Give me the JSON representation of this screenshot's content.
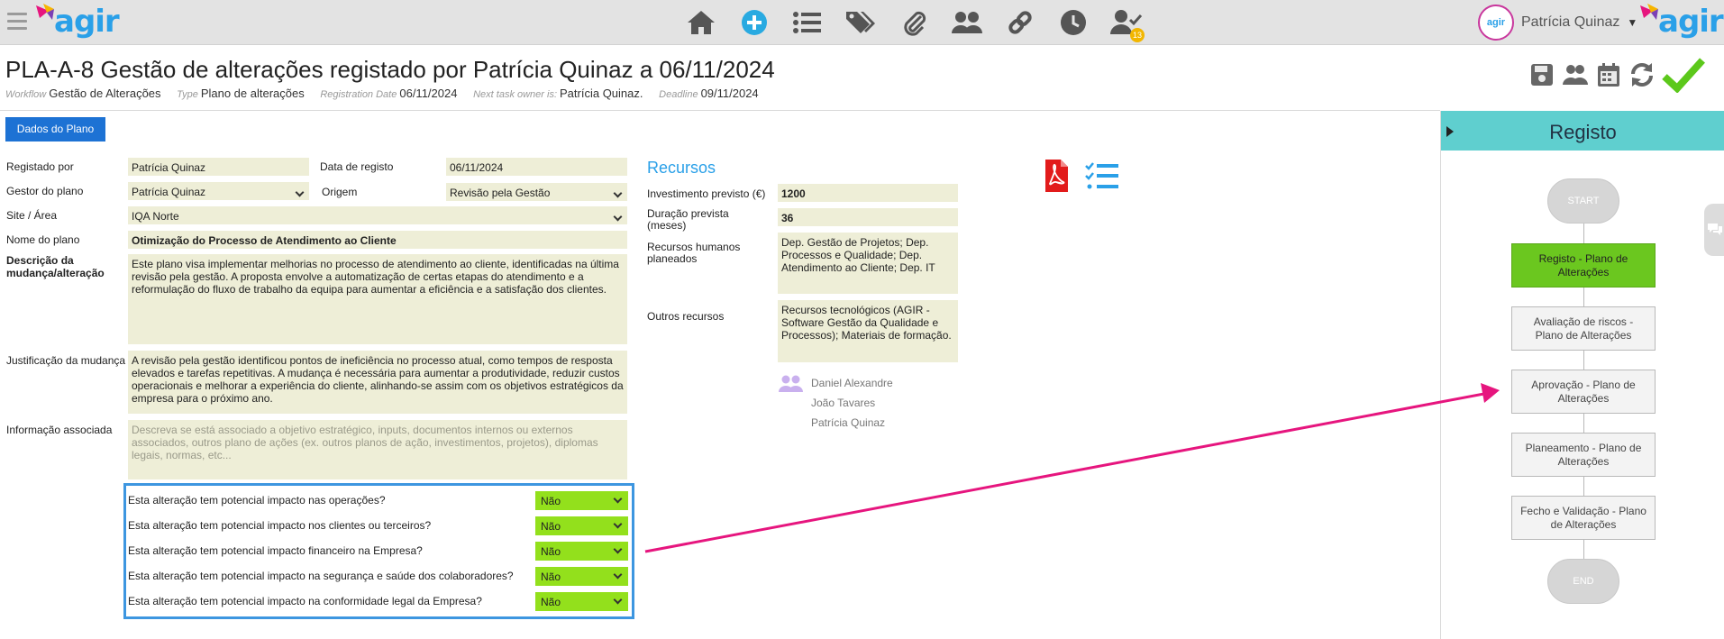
{
  "app": {
    "logo_text": "agir",
    "logo_text_right": "agir",
    "accent": "#2aa0e8",
    "highlight": "#e6157e"
  },
  "nav": {
    "icons": [
      "home-icon",
      "add-circle-icon",
      "list-icon",
      "tags-icon",
      "paperclip-icon",
      "users-icon",
      "link-icon",
      "clock-icon",
      "user-check-icon"
    ],
    "badge": "13"
  },
  "user": {
    "avatar_text": "agir",
    "name": "Patrícia Quinaz"
  },
  "header": {
    "title": "PLA-A-8 Gestão de alterações registado por Patrícia Quinaz a 06/11/2024",
    "meta": [
      {
        "k": "Workflow",
        "v": "Gestão de Alterações"
      },
      {
        "k": "Type",
        "v": "Plano de alterações"
      },
      {
        "k": "Registration Date",
        "v": "06/11/2024"
      },
      {
        "k": "Next task owner is:",
        "v": "Patrícia Quinaz."
      },
      {
        "k": "Deadline",
        "v": "09/11/2024"
      }
    ]
  },
  "tools": [
    "save-icon",
    "users-icon",
    "calendar-icon",
    "refresh-icon",
    "check-icon"
  ],
  "tab_button": "Dados do Plano",
  "form": {
    "registado_por": {
      "label": "Registado por",
      "value": "Patrícia Quinaz"
    },
    "data_registo": {
      "label": "Data de registo",
      "value": "06/11/2024"
    },
    "gestor": {
      "label": "Gestor do plano",
      "value": "Patrícia Quinaz"
    },
    "origem": {
      "label": "Origem",
      "value": "Revisão pela Gestão"
    },
    "site": {
      "label": "Site / Área",
      "value": "IQA Norte"
    },
    "nome": {
      "label": "Nome do plano",
      "value": "Otimização do Processo de Atendimento ao Cliente"
    },
    "descricao": {
      "label": "Descrição da mudança/alteração",
      "value": "Este plano visa implementar melhorias no processo de atendimento ao cliente, identificadas na última revisão pela gestão. A proposta envolve a automatização de certas etapas do atendimento e a reformulação do fluxo de trabalho da equipa para aumentar a eficiência e a satisfação dos clientes."
    },
    "justificacao": {
      "label": "Justificação da mudança",
      "value": "A revisão pela gestão identificou pontos de ineficiência no processo atual, como tempos de resposta elevados e tarefas repetitivas. A mudança é necessária para aumentar a produtividade, reduzir custos operacionais e melhorar a experiência do cliente, alinhando-se assim com os objetivos estratégicos da empresa para o próximo ano."
    },
    "informacao": {
      "label": "Informação associada",
      "placeholder": "Descreva se está associado a objetivo estratégico, inputs, documentos internos ou externos associados, outros plano de ações (ex. outros planos de ação, investimentos, projetos), diplomas legais, normas, etc..."
    }
  },
  "recursos": {
    "title": "Recursos",
    "investimento": {
      "label": "Investimento previsto (€)",
      "value": "1200"
    },
    "duracao": {
      "label": "Duração prevista (meses)",
      "value": "36"
    },
    "humanos": {
      "label": "Recursos humanos planeados",
      "value": "Dep. Gestão de Projetos; Dep. Processos e Qualidade; Dep. Atendimento ao Cliente; Dep. IT"
    },
    "outros": {
      "label": "Outros recursos",
      "value": "Recursos tecnológicos (AGIR - Software Gestão da Qualidade e Processos); Materiais de formação."
    },
    "team": [
      "Daniel Alexandre",
      "João Tavares",
      "Patrícia Quinaz"
    ]
  },
  "impacts": [
    {
      "q": "Esta alteração tem potencial impacto nas operações?",
      "a": "Não"
    },
    {
      "q": "Esta alteração tem potencial impacto nos clientes ou terceiros?",
      "a": "Não"
    },
    {
      "q": "Esta alteração tem potencial impacto financeiro na Empresa?",
      "a": "Não"
    },
    {
      "q": "Esta alteração tem potencial impacto na segurança e saúde dos colaboradores?",
      "a": "Não"
    },
    {
      "q": "Esta alteração tem potencial impacto na conformidade legal da Empresa?",
      "a": "Não"
    }
  ],
  "workflow": {
    "title": "Registo",
    "start": "START",
    "end": "END",
    "steps": [
      {
        "label": "Registo - Plano de Alterações",
        "active": true
      },
      {
        "label": "Avaliação de riscos - Plano de Alterações",
        "active": false
      },
      {
        "label": "Aprovação - Plano de Alterações",
        "active": false
      },
      {
        "label": "Planeamento - Plano de Alterações",
        "active": false
      },
      {
        "label": "Fecho e Validação - Plano de Alterações",
        "active": false
      }
    ]
  }
}
